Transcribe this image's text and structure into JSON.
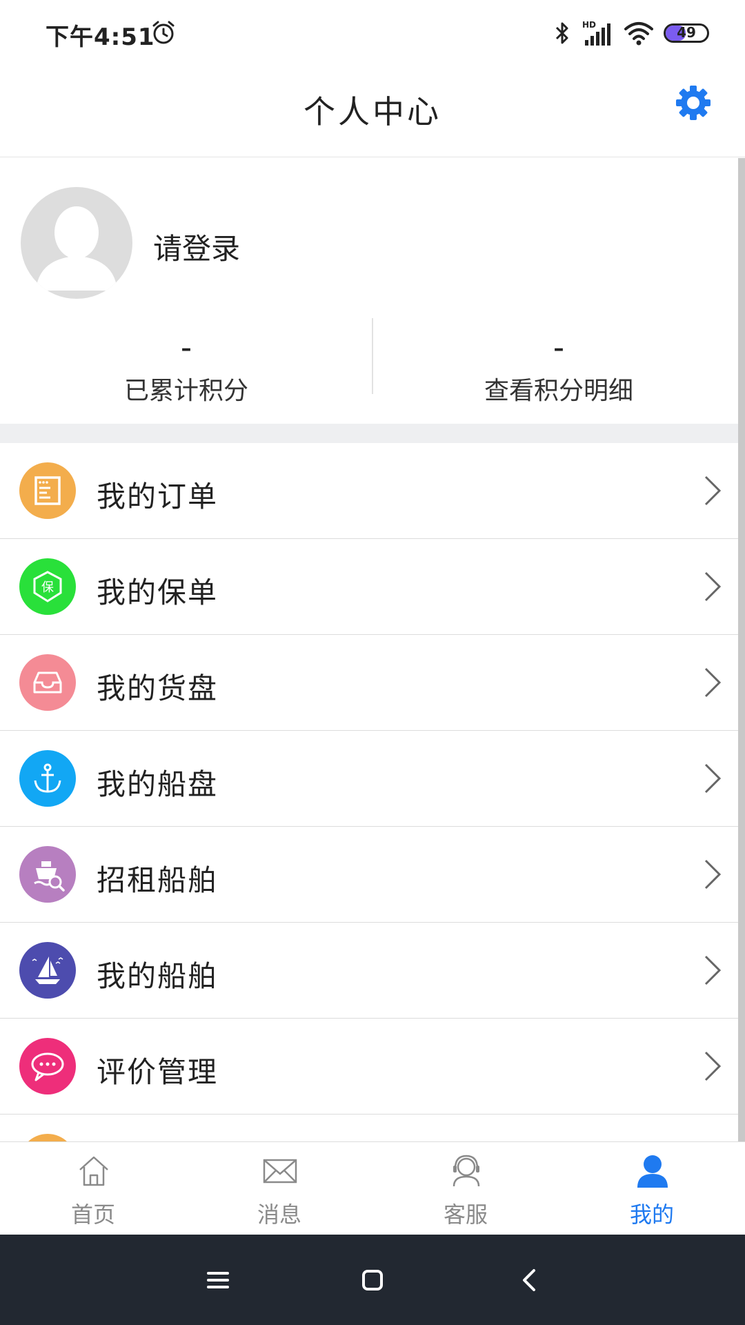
{
  "status_bar": {
    "time": "下午4:51",
    "battery_level": "49",
    "battery_fraction": 0.49,
    "icons": [
      "alarm-icon",
      "bluetooth-icon",
      "hd-signal-icon",
      "wifi-icon",
      "battery-icon"
    ]
  },
  "header": {
    "title": "个人中心",
    "settings_icon": "gear-icon"
  },
  "profile": {
    "login_prompt": "请登录",
    "points_value": "–",
    "points_label": "已累计积分",
    "details_value": "–",
    "details_label": "查看积分明细"
  },
  "menu": {
    "items": [
      {
        "label": "我的订单",
        "icon": "order-icon",
        "color": "#f3ad4c"
      },
      {
        "label": "我的保单",
        "icon": "insurance-icon",
        "color": "#29e03a"
      },
      {
        "label": "我的货盘",
        "icon": "inbox-icon",
        "color": "#f48b95"
      },
      {
        "label": "我的船盘",
        "icon": "anchor-icon",
        "color": "#12a7f4"
      },
      {
        "label": "招租船舶",
        "icon": "ship-search-icon",
        "color": "#b77fc0"
      },
      {
        "label": "我的船舶",
        "icon": "sailboat-icon",
        "color": "#4d4cae"
      },
      {
        "label": "评价管理",
        "icon": "chat-bubble-icon",
        "color": "#ee2e7a"
      }
    ]
  },
  "bottom_nav": {
    "items": [
      {
        "label": "首页",
        "icon": "home-icon",
        "active": false
      },
      {
        "label": "消息",
        "icon": "mail-icon",
        "active": false
      },
      {
        "label": "客服",
        "icon": "headset-icon",
        "active": false
      },
      {
        "label": "我的",
        "icon": "user-icon",
        "active": true
      }
    ],
    "active_color": "#1f7af0",
    "inactive_color": "#8a8a8a"
  },
  "system_nav": {
    "icons": [
      "menu-icon",
      "home-square-icon",
      "back-icon"
    ]
  }
}
